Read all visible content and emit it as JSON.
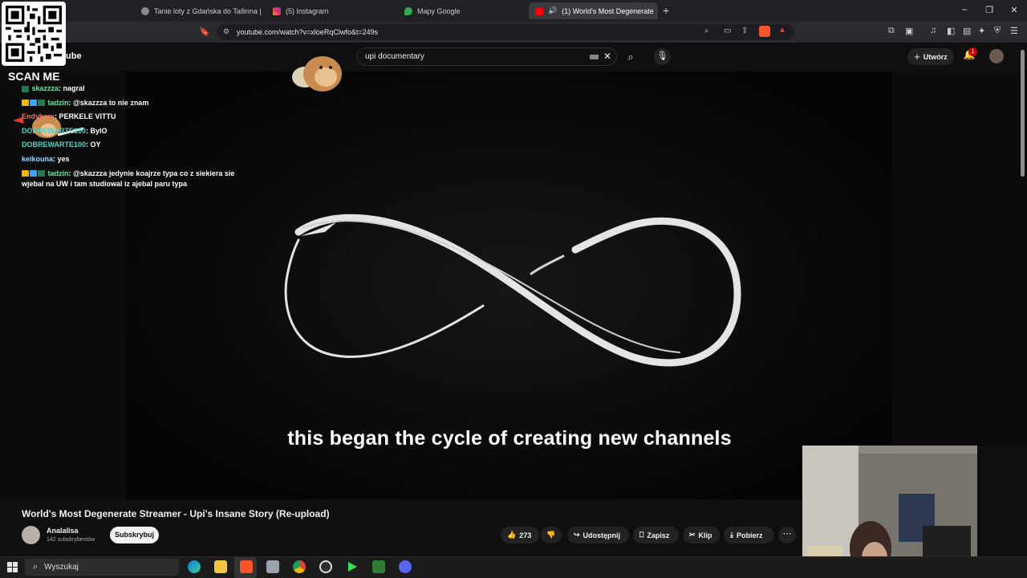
{
  "browser": {
    "tabs": [
      {
        "label": "Tanie loty z Gdańska do Tallinna | Wi",
        "active": false
      },
      {
        "label": "(5) Instagram",
        "active": false
      },
      {
        "label": "Mapy Google",
        "active": false
      },
      {
        "label": "(1) World's Most Degenerate",
        "active": true
      }
    ],
    "new_tab": "+",
    "url": "youtube.com/watch?v=xloeRqClwfo&t=249s"
  },
  "overlay": {
    "scan_me": "SCAN ME",
    "yt_logo_fragment": "ube",
    "chat": [
      {
        "user": "skazzza",
        "user_color": "#6be3a0",
        "message": "nagral"
      },
      {
        "user": "tadzin",
        "user_color": "#6be3a0",
        "message": "@skazzza to nie znam"
      },
      {
        "user": "Endyhere",
        "user_color": "#ff6b6b",
        "message": "PERKELE VITTU"
      },
      {
        "user": "DOBREWARTE100",
        "user_color": "#4fd1c5",
        "message": "BylO"
      },
      {
        "user": "DOBREWARTE100",
        "user_color": "#4fd1c5",
        "message": "OY"
      },
      {
        "user": "keikouna",
        "user_color": "#9ad6ff",
        "message": "yes"
      },
      {
        "user": "tadzin",
        "user_color": "#6be3a0",
        "message": "@skazzza jedynie koajrze typa co z siekiera sie wjebal na UW i tam studiowal iz ajebal paru typa"
      }
    ]
  },
  "youtube": {
    "search_value": "upi documentary",
    "create_label": "Utwórz",
    "notif_count": "1",
    "subtitle": "this began the cycle of creating new channels",
    "video_title": "World's Most Degenerate Streamer - Upi's Insane Story (Re-upload)",
    "channel_name": "Analalisa",
    "channel_subs": "142 subskrybentów",
    "subscribe_label": "Subskrybuj",
    "likes": "273",
    "share_label": "Udostępnij",
    "save_label": "Zapisz",
    "clip_label": "Klip",
    "download_label": "Pobierz"
  },
  "taskbar": {
    "search_label": "Wyszukaj"
  },
  "colors": {
    "youtube_red": "#ff0000",
    "background": "#0f0f0f"
  }
}
